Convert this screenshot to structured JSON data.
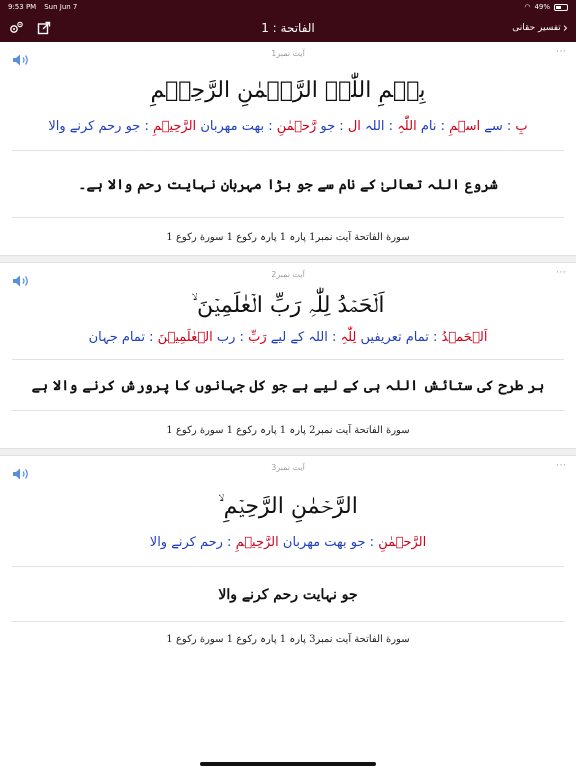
{
  "status_bar": {
    "time": "9:53 PM",
    "date": "Sun Jun 7",
    "battery": "49%",
    "battery_level": 0.49
  },
  "nav": {
    "back_label": "تفسیر حقانی",
    "title": "الفاتحة : 1"
  },
  "ayahs": [
    {
      "number_label": "آیت نمبر1",
      "arabic": "بِسۡمِ اللّٰہِ الرَّحۡمٰنِ الرَّحِیۡمِ",
      "words": [
        {
          "ar": "بِ",
          "ur": "سے"
        },
        {
          "ar": "اسۡمِ",
          "ur": "نام"
        },
        {
          "ar": "اللّٰہِ",
          "ur": "اللہ"
        },
        {
          "ar": "ال",
          "ur": "جو"
        },
        {
          "ar": "رَّحۡمٰنِ",
          "ur": "بھت مھربان"
        },
        {
          "ar": "الرَّحِیۡمِ",
          "ur": "جو رحم کرنے والا"
        }
      ],
      "translation": "شروع اللہ تعالیٰ کے نام سے جو بڑا مہربان نہایت رحم والا ہے۔",
      "reference": "سورة الفاتحة آیت نمبر1 پارہ 1 پارہ رکوع 1 سورة رکوع 1"
    },
    {
      "number_label": "آیت نمبر2",
      "arabic": "اَلۡحَمۡدُ لِلّٰہِ رَبِّ الۡعٰلَمِیۡنَ ۙ",
      "words": [
        {
          "ar": "اَلۡحَمۡدُ",
          "ur": "تمام تعریفیں"
        },
        {
          "ar": "لِلّٰہِ",
          "ur": "اللہ کے لیے"
        },
        {
          "ar": "رَبِّ",
          "ur": "رب"
        },
        {
          "ar": "الۡعٰلَمِیۡنَ",
          "ur": "تمام جہان"
        }
      ],
      "translation": "ہر طرح کی ستائش اللہ ہی کے لیے ہے جو کل جہانوں کا پرورش کرنے والا ہے",
      "reference": "سورة الفاتحة آیت نمبر2 پارہ 1 پارہ رکوع 1 سورة رکوع 1"
    },
    {
      "number_label": "آیت نمبر3",
      "arabic": "الرَّحۡمٰنِ الرَّحِیۡمِ ۙ",
      "words": [
        {
          "ar": "الرَّحۡمٰنِ",
          "ur": "جو بھت مھربان"
        },
        {
          "ar": "الرَّحِیۡمِ",
          "ur": "رحم کرنے والا"
        }
      ],
      "translation": "جو نہایت رحم کرنے والا",
      "reference": "سورة الفاتحة آیت نمبر3 پارہ 1 پارہ رکوع 1 سورة رکوع 1"
    }
  ],
  "colors": {
    "nav_background": "#3c0a14",
    "arabic_word": "#d0021b",
    "urdu_meaning": "#1f3fbf",
    "speaker_icon": "#5b8fd9"
  }
}
